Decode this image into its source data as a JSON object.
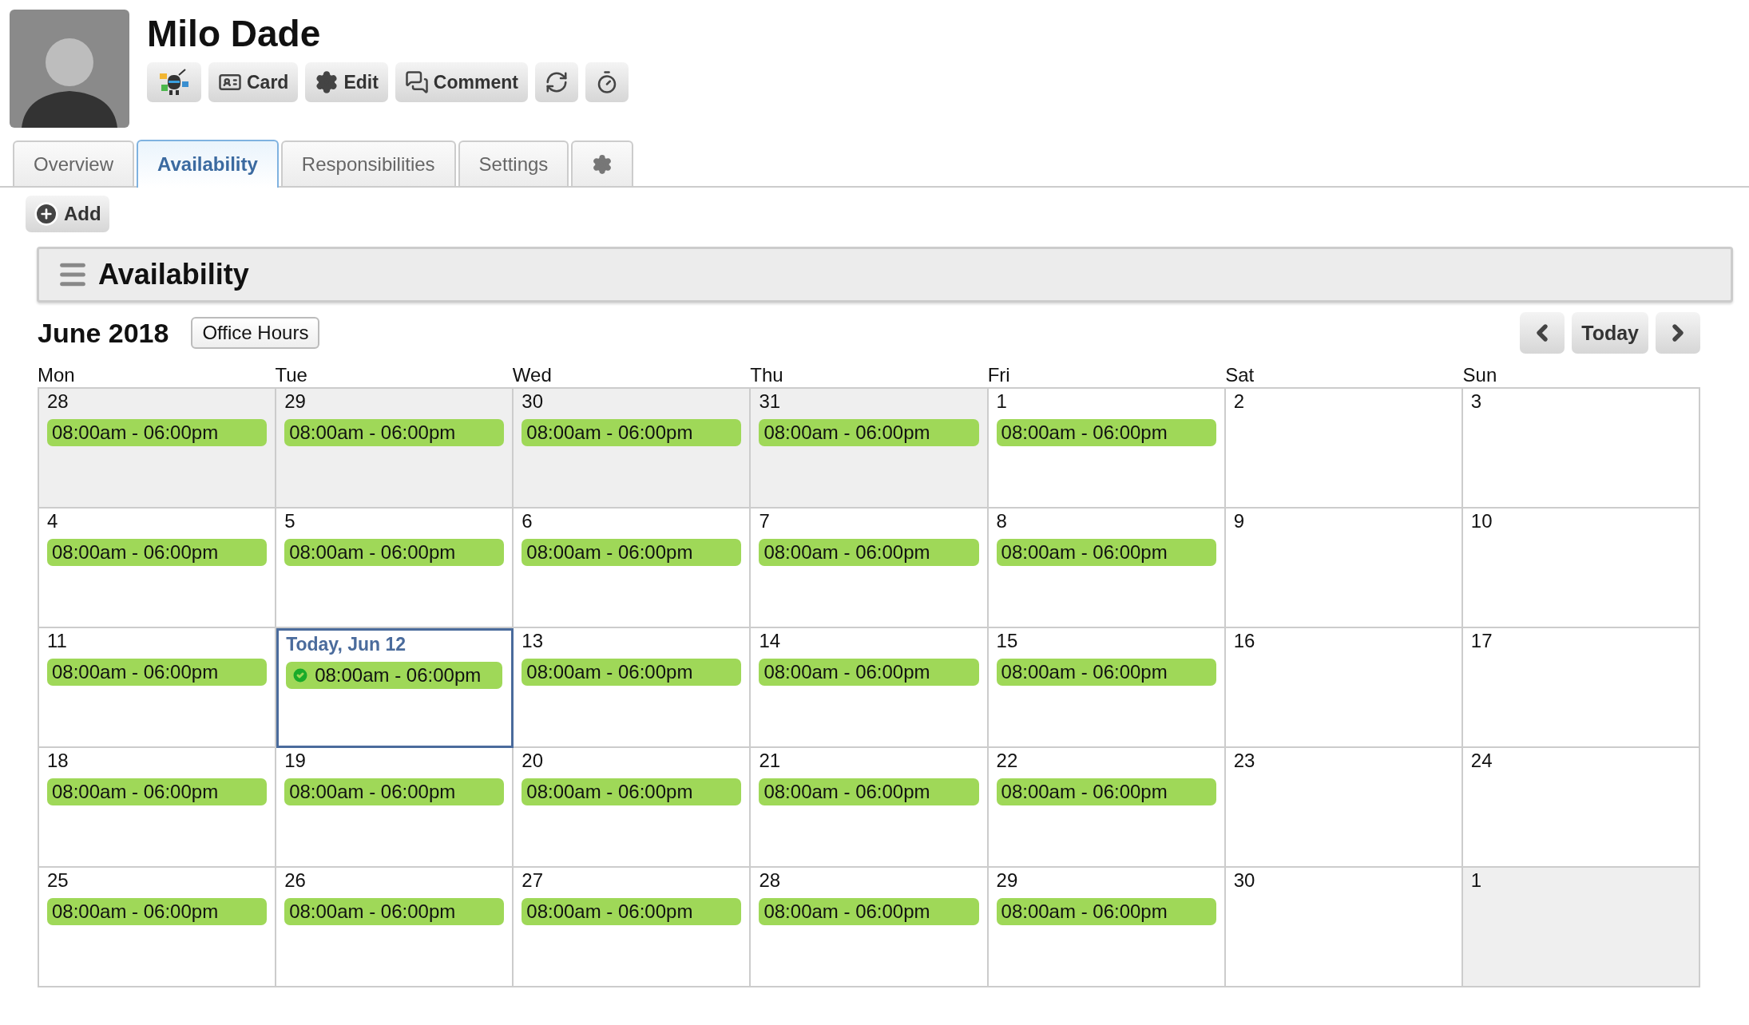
{
  "profile": {
    "name": "Milo Dade"
  },
  "toolbar": [
    {
      "kind": "robot"
    },
    {
      "kind": "card",
      "label": "Card"
    },
    {
      "kind": "gear",
      "label": "Edit"
    },
    {
      "kind": "comment",
      "label": "Comment"
    },
    {
      "kind": "refresh"
    },
    {
      "kind": "timer"
    }
  ],
  "tabs": [
    {
      "kind": "text",
      "label": "Overview",
      "selected": false
    },
    {
      "kind": "text",
      "label": "Availability",
      "selected": true
    },
    {
      "kind": "text",
      "label": "Responsibilities",
      "selected": false
    },
    {
      "kind": "text",
      "label": "Settings",
      "selected": false
    },
    {
      "kind": "gear",
      "selected": false
    }
  ],
  "add_button": {
    "label": "Add"
  },
  "panel": {
    "title": "Availability"
  },
  "calendar": {
    "month": "June 2018",
    "view_button": "Office Hours",
    "today_button": "Today",
    "weekdays": [
      "Mon",
      "Tue",
      "Wed",
      "Thu",
      "Fri",
      "Sat",
      "Sun"
    ],
    "weeks": [
      [
        {
          "label": "28",
          "outside": true,
          "today": false,
          "events": [
            {
              "time": "08:00am - 06:00pm",
              "done": false
            }
          ]
        },
        {
          "label": "29",
          "outside": true,
          "today": false,
          "events": [
            {
              "time": "08:00am - 06:00pm",
              "done": false
            }
          ]
        },
        {
          "label": "30",
          "outside": true,
          "today": false,
          "events": [
            {
              "time": "08:00am - 06:00pm",
              "done": false
            }
          ]
        },
        {
          "label": "31",
          "outside": true,
          "today": false,
          "events": [
            {
              "time": "08:00am - 06:00pm",
              "done": false
            }
          ]
        },
        {
          "label": "1",
          "outside": false,
          "today": false,
          "events": [
            {
              "time": "08:00am - 06:00pm",
              "done": false
            }
          ]
        },
        {
          "label": "2",
          "outside": false,
          "today": false
        },
        {
          "label": "3",
          "outside": false,
          "today": false
        }
      ],
      [
        {
          "label": "4",
          "outside": false,
          "today": false,
          "events": [
            {
              "time": "08:00am - 06:00pm",
              "done": false
            }
          ]
        },
        {
          "label": "5",
          "outside": false,
          "today": false,
          "events": [
            {
              "time": "08:00am - 06:00pm",
              "done": false
            }
          ]
        },
        {
          "label": "6",
          "outside": false,
          "today": false,
          "events": [
            {
              "time": "08:00am - 06:00pm",
              "done": false
            }
          ]
        },
        {
          "label": "7",
          "outside": false,
          "today": false,
          "events": [
            {
              "time": "08:00am - 06:00pm",
              "done": false
            }
          ]
        },
        {
          "label": "8",
          "outside": false,
          "today": false,
          "events": [
            {
              "time": "08:00am - 06:00pm",
              "done": false
            }
          ]
        },
        {
          "label": "9",
          "outside": false,
          "today": false
        },
        {
          "label": "10",
          "outside": false,
          "today": false
        }
      ],
      [
        {
          "label": "11",
          "outside": false,
          "today": false,
          "events": [
            {
              "time": "08:00am - 06:00pm",
              "done": false
            }
          ]
        },
        {
          "label": "Today, Jun 12",
          "outside": false,
          "today": true,
          "events": [
            {
              "time": "08:00am - 06:00pm",
              "done": true
            }
          ]
        },
        {
          "label": "13",
          "outside": false,
          "today": false,
          "events": [
            {
              "time": "08:00am - 06:00pm",
              "done": false
            }
          ]
        },
        {
          "label": "14",
          "outside": false,
          "today": false,
          "events": [
            {
              "time": "08:00am - 06:00pm",
              "done": false
            }
          ]
        },
        {
          "label": "15",
          "outside": false,
          "today": false,
          "events": [
            {
              "time": "08:00am - 06:00pm",
              "done": false
            }
          ]
        },
        {
          "label": "16",
          "outside": false,
          "today": false
        },
        {
          "label": "17",
          "outside": false,
          "today": false
        }
      ],
      [
        {
          "label": "18",
          "outside": false,
          "today": false,
          "events": [
            {
              "time": "08:00am - 06:00pm",
              "done": false
            }
          ]
        },
        {
          "label": "19",
          "outside": false,
          "today": false,
          "events": [
            {
              "time": "08:00am - 06:00pm",
              "done": false
            }
          ]
        },
        {
          "label": "20",
          "outside": false,
          "today": false,
          "events": [
            {
              "time": "08:00am - 06:00pm",
              "done": false
            }
          ]
        },
        {
          "label": "21",
          "outside": false,
          "today": false,
          "events": [
            {
              "time": "08:00am - 06:00pm",
              "done": false
            }
          ]
        },
        {
          "label": "22",
          "outside": false,
          "today": false,
          "events": [
            {
              "time": "08:00am - 06:00pm",
              "done": false
            }
          ]
        },
        {
          "label": "23",
          "outside": false,
          "today": false
        },
        {
          "label": "24",
          "outside": false,
          "today": false
        }
      ],
      [
        {
          "label": "25",
          "outside": false,
          "today": false,
          "events": [
            {
              "time": "08:00am - 06:00pm",
              "done": false
            }
          ]
        },
        {
          "label": "26",
          "outside": false,
          "today": false,
          "events": [
            {
              "time": "08:00am - 06:00pm",
              "done": false
            }
          ]
        },
        {
          "label": "27",
          "outside": false,
          "today": false,
          "events": [
            {
              "time": "08:00am - 06:00pm",
              "done": false
            }
          ]
        },
        {
          "label": "28",
          "outside": false,
          "today": false,
          "events": [
            {
              "time": "08:00am - 06:00pm",
              "done": false
            }
          ]
        },
        {
          "label": "29",
          "outside": false,
          "today": false,
          "events": [
            {
              "time": "08:00am - 06:00pm",
              "done": false
            }
          ]
        },
        {
          "label": "30",
          "outside": false,
          "today": false
        },
        {
          "label": "1",
          "outside": true,
          "today": false
        }
      ]
    ]
  }
}
